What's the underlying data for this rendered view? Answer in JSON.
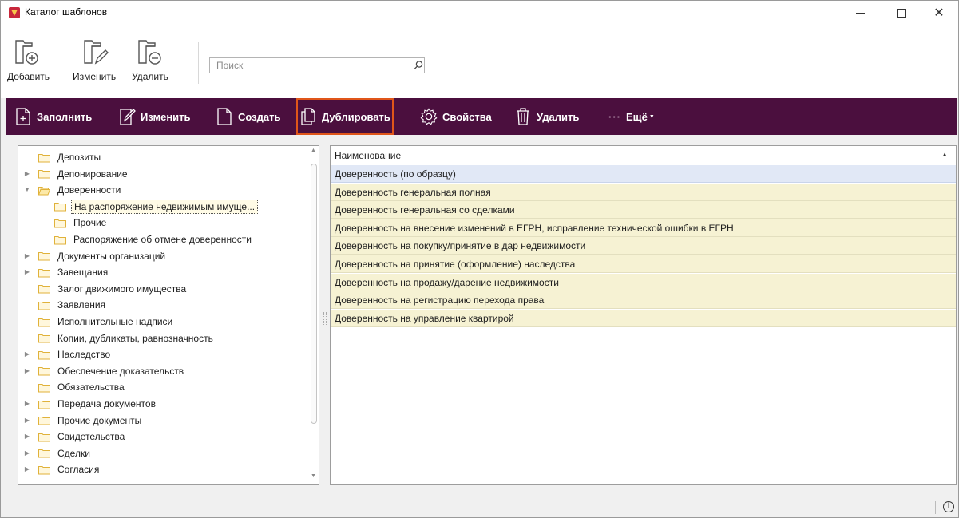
{
  "window": {
    "title": "Каталог шаблонов",
    "controls": [
      "minimize",
      "maximize",
      "close"
    ]
  },
  "toolbar": {
    "buttons": [
      {
        "label": "Добавить",
        "icon": "folder-add-icon"
      },
      {
        "label": "Изменить",
        "icon": "folder-edit-icon"
      },
      {
        "label": "Удалить",
        "icon": "folder-remove-icon"
      }
    ],
    "search": {
      "placeholder": "Поиск",
      "value": ""
    }
  },
  "actions": {
    "fill": "Заполнить",
    "edit": "Изменить",
    "create": "Создать",
    "duplicate": "Дублировать",
    "properties": "Свойства",
    "delete": "Удалить",
    "more": "Ещё"
  },
  "tree": {
    "items": [
      {
        "label": "Депозиты",
        "level": 0,
        "expander": "none"
      },
      {
        "label": "Депонирование",
        "level": 0,
        "expander": "collapsed"
      },
      {
        "label": "Доверенности",
        "level": 0,
        "expander": "expanded",
        "open": true
      },
      {
        "label": "На распоряжение недвижимым имуще...",
        "level": 1,
        "expander": "none",
        "selected": true
      },
      {
        "label": "Прочие",
        "level": 1,
        "expander": "none"
      },
      {
        "label": "Распоряжение об отмене доверенности",
        "level": 1,
        "expander": "none"
      },
      {
        "label": "Документы организаций",
        "level": 0,
        "expander": "collapsed"
      },
      {
        "label": "Завещания",
        "level": 0,
        "expander": "collapsed"
      },
      {
        "label": "Залог движимого имущества",
        "level": 0,
        "expander": "none"
      },
      {
        "label": "Заявления",
        "level": 0,
        "expander": "none"
      },
      {
        "label": "Исполнительные надписи",
        "level": 0,
        "expander": "none"
      },
      {
        "label": "Копии, дубликаты, равнозначность",
        "level": 0,
        "expander": "none"
      },
      {
        "label": "Наследство",
        "level": 0,
        "expander": "collapsed"
      },
      {
        "label": "Обеспечение доказательств",
        "level": 0,
        "expander": "collapsed"
      },
      {
        "label": "Обязательства",
        "level": 0,
        "expander": "none"
      },
      {
        "label": "Передача документов",
        "level": 0,
        "expander": "collapsed"
      },
      {
        "label": "Прочие документы",
        "level": 0,
        "expander": "collapsed"
      },
      {
        "label": "Свидетельства",
        "level": 0,
        "expander": "collapsed"
      },
      {
        "label": "Сделки",
        "level": 0,
        "expander": "collapsed"
      },
      {
        "label": "Согласия",
        "level": 0,
        "expander": "collapsed"
      }
    ]
  },
  "grid": {
    "column": "Наименование",
    "rows": [
      "Доверенность (по образцу)",
      "Доверенность генеральная полная",
      "Доверенность генеральная со сделками",
      "Доверенность на внесение изменений в ЕГРН, исправление технической ошибки в ЕГРН",
      "Доверенность на покупку/принятие в дар недвижимости",
      "Доверенность на принятие (оформление) наследства",
      "Доверенность на продажу/дарение недвижимости",
      "Доверенность на регистрацию перехода права",
      "Доверенность на управление квартирой"
    ]
  },
  "colors": {
    "action_bar": "#4b0f3e",
    "highlight": "#e0561a",
    "row_bg": "#f6f2d3",
    "row_selected": "#e1e8f6",
    "folder": "#f5c842"
  }
}
